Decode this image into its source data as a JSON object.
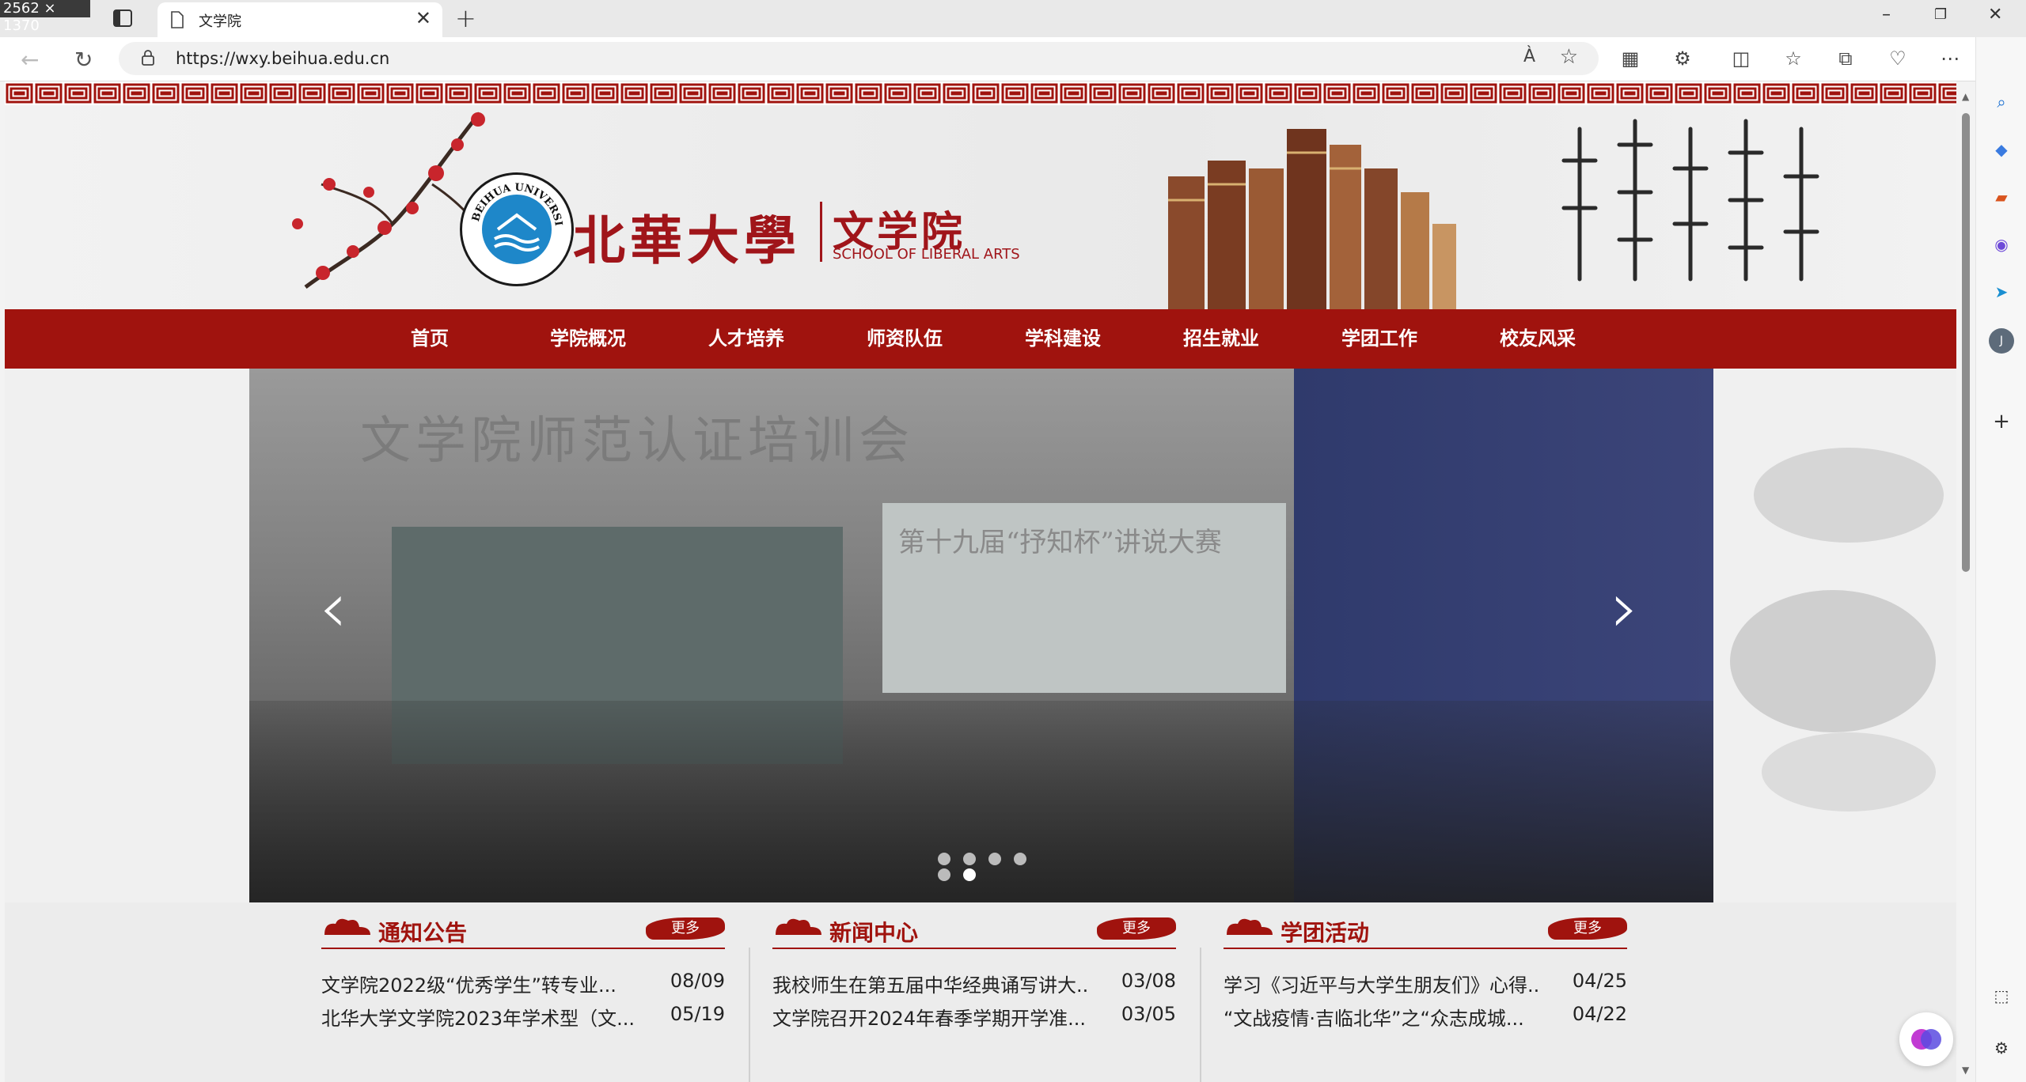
{
  "screen_dims_label": "2562 × 1370",
  "browser": {
    "tab": {
      "title": "文学院",
      "close": "✕"
    },
    "new_tab": "+",
    "window": {
      "minimize": "–",
      "restore": "❐",
      "close": "✕"
    },
    "address": {
      "url": "https://wxy.beihua.edu.cn",
      "read_aloud": "À",
      "favorite": "☆"
    },
    "icons": [
      "back-icon",
      "refresh-icon",
      "lock-icon",
      "reading-view-icon",
      "extensions-icon",
      "split-screen-icon",
      "favorites-icon",
      "collections-icon",
      "performance-icon",
      "more-icon",
      "sidebar-toggle-icon"
    ]
  },
  "sidebar": {
    "items": [
      "search-icon",
      "shopping-icon",
      "tools-icon",
      "office-icon",
      "send-icon",
      "profile-icon",
      "add-icon",
      "screenshot-icon",
      "settings-icon"
    ],
    "profile_letter": "J",
    "add_label": "+"
  },
  "site": {
    "school_name": "北華大學",
    "college_name": "文学院",
    "college_en": "SCHOOL OF LIBERAL ARTS",
    "logo_ring_text": "BEIHUA UNIVERSITY",
    "nav": [
      "首页",
      "学院概况",
      "人才培养",
      "师资队伍",
      "学科建设",
      "招生就业",
      "学团工作",
      "校友风采"
    ],
    "slide": {
      "title": "文学院师范认证培训会",
      "screen_text": "第十九届“抒知杯”讲说大赛",
      "prev": "‹",
      "next": "›",
      "slide_count": 6,
      "active_index": 5
    },
    "sections": [
      {
        "title": "通知公告",
        "more": "更多",
        "items": [
          {
            "text": "文学院2022级“优秀学生”转专业...",
            "date": "08/09"
          },
          {
            "text": "北华大学文学院2023年学术型（文...",
            "date": "05/19"
          }
        ]
      },
      {
        "title": "新闻中心",
        "more": "更多",
        "items": [
          {
            "text": "我校师生在第五届中华经典诵写讲大...",
            "date": "03/08"
          },
          {
            "text": "文学院召开2024年春季学期开学准...",
            "date": "03/05"
          }
        ]
      },
      {
        "title": "学团活动",
        "more": "更多",
        "items": [
          {
            "text": "学习《习近平与大学生朋友们》心得...",
            "date": "04/25"
          },
          {
            "text": "“文战疫情·吉临北华”之“众志成城...",
            "date": "04/22"
          }
        ]
      }
    ]
  },
  "colors": {
    "brand_red": "#a0130e",
    "logo_blue": "#1e87c9"
  }
}
